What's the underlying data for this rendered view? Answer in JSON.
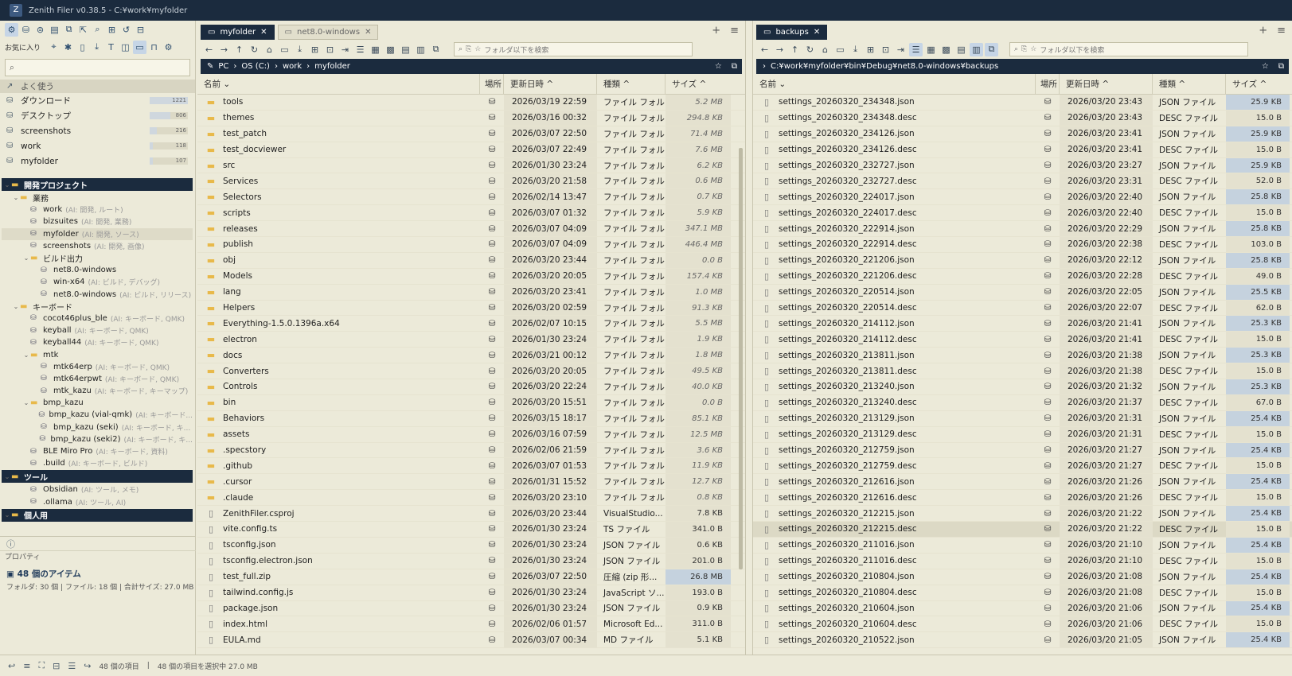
{
  "window_title": "Zenith Filer v0.38.5 - C:¥work¥myfolder",
  "left": {
    "fav_label": "お気に入り",
    "search_placeholder": "",
    "favorites_header": "よく使う",
    "favorites": [
      {
        "label": "ダウンロード",
        "count": "1221",
        "fill": 1.0
      },
      {
        "label": "デスクトップ",
        "count": "806",
        "fill": 0.55
      },
      {
        "label": "screenshots",
        "count": "216",
        "fill": 0.18
      },
      {
        "label": "work",
        "count": "118",
        "fill": 0.09
      },
      {
        "label": "myfolder",
        "count": "107",
        "fill": 0.08
      }
    ],
    "tree": [
      {
        "kind": "grp",
        "label": "開発プロジェクト",
        "indent": 0
      },
      {
        "kind": "fold",
        "label": "業務",
        "indent": 1
      },
      {
        "kind": "drv",
        "label": "work",
        "tag": "(AI: 開発, ルート)",
        "indent": 2
      },
      {
        "kind": "drv",
        "label": "bizsuites",
        "tag": "(AI: 開発, 業務)",
        "indent": 2
      },
      {
        "kind": "drv",
        "label": "myfolder",
        "tag": "(AI: 開発, ソース)",
        "indent": 2,
        "sel": true
      },
      {
        "kind": "drv",
        "label": "screenshots",
        "tag": "(AI: 開発, 画像)",
        "indent": 2
      },
      {
        "kind": "fold",
        "label": "ビルド出力",
        "indent": 2
      },
      {
        "kind": "drv",
        "label": "net8.0-windows",
        "tag": "",
        "indent": 3
      },
      {
        "kind": "drv",
        "label": "win-x64",
        "tag": "(AI: ビルド, デバッグ)",
        "indent": 3
      },
      {
        "kind": "drv",
        "label": "net8.0-windows",
        "tag": "(AI: ビルド, リリース)",
        "indent": 3
      },
      {
        "kind": "fold",
        "label": "キーボード",
        "indent": 1
      },
      {
        "kind": "drv",
        "label": "cocot46plus_ble",
        "tag": "(AI: キーボード, QMK)",
        "indent": 2
      },
      {
        "kind": "drv",
        "label": "keyball",
        "tag": "(AI: キーボード, QMK)",
        "indent": 2
      },
      {
        "kind": "drv",
        "label": "keyball44",
        "tag": "(AI: キーボード, QMK)",
        "indent": 2
      },
      {
        "kind": "fold",
        "label": "mtk",
        "indent": 2
      },
      {
        "kind": "drv",
        "label": "mtk64erp",
        "tag": "(AI: キーボード, QMK)",
        "indent": 3
      },
      {
        "kind": "drv",
        "label": "mtk64erpwt",
        "tag": "(AI: キーボード, QMK)",
        "indent": 3
      },
      {
        "kind": "drv",
        "label": "mtk_kazu",
        "tag": "(AI: キーボード, キーマップ)",
        "indent": 3
      },
      {
        "kind": "fold",
        "label": "bmp_kazu",
        "indent": 2
      },
      {
        "kind": "drv",
        "label": "bmp_kazu (vial-qmk)",
        "tag": "(AI: キーボード...",
        "indent": 3
      },
      {
        "kind": "drv",
        "label": "bmp_kazu (seki)",
        "tag": "(AI: キーボード, キ...",
        "indent": 3
      },
      {
        "kind": "drv",
        "label": "bmp_kazu (seki2)",
        "tag": "(AI: キーボード, キ...",
        "indent": 3
      },
      {
        "kind": "drv",
        "label": "BLE Miro Pro",
        "tag": "(AI: キーボード, 資料)",
        "indent": 2
      },
      {
        "kind": "drv",
        "label": ".build",
        "tag": "(AI: キーボード, ビルド)",
        "indent": 2
      },
      {
        "kind": "grp",
        "label": "ツール",
        "indent": 0
      },
      {
        "kind": "drv",
        "label": "Obsidian",
        "tag": "(AI: ツール, メモ)",
        "indent": 2
      },
      {
        "kind": "drv",
        "label": ".ollama",
        "tag": "(AI: ツール, AI)",
        "indent": 2
      },
      {
        "kind": "grp",
        "label": "個人用",
        "indent": 0
      }
    ],
    "props_label": "プロパティ",
    "props_title": "48 個のアイテム",
    "props_summary": "フォルダ: 30 個 | ファイル: 18 個 | 合計サイズ: 27.0 MB"
  },
  "pane1": {
    "tabs": [
      "myfolder",
      "net8.0-windows"
    ],
    "search_placeholder": "フォルダ以下を検索",
    "breadcrumb": [
      "PC",
      "OS (C:)",
      "work",
      "myfolder"
    ],
    "columns": [
      "名前",
      "場所",
      "更新日時",
      "種類",
      "サイズ"
    ],
    "rows": [
      {
        "n": "tools",
        "d": "2026/03/19 22:59",
        "t": "ファイル フォル...",
        "s": "5.2 MB",
        "f": 1
      },
      {
        "n": "themes",
        "d": "2026/03/16 00:32",
        "t": "ファイル フォル...",
        "s": "294.8 KB",
        "f": 1
      },
      {
        "n": "test_patch",
        "d": "2026/03/07 22:50",
        "t": "ファイル フォル...",
        "s": "71.4 MB",
        "f": 1
      },
      {
        "n": "test_docviewer",
        "d": "2026/03/07 22:49",
        "t": "ファイル フォル...",
        "s": "7.6 MB",
        "f": 1
      },
      {
        "n": "src",
        "d": "2026/01/30 23:24",
        "t": "ファイル フォル...",
        "s": "6.2 KB",
        "f": 1
      },
      {
        "n": "Services",
        "d": "2026/03/20 21:58",
        "t": "ファイル フォル...",
        "s": "0.6 MB",
        "f": 1
      },
      {
        "n": "Selectors",
        "d": "2026/02/14 13:47",
        "t": "ファイル フォル...",
        "s": "0.7 KB",
        "f": 1
      },
      {
        "n": "scripts",
        "d": "2026/03/07 01:32",
        "t": "ファイル フォル...",
        "s": "5.9 KB",
        "f": 1
      },
      {
        "n": "releases",
        "d": "2026/03/07 04:09",
        "t": "ファイル フォル...",
        "s": "347.1 MB",
        "f": 1
      },
      {
        "n": "publish",
        "d": "2026/03/07 04:09",
        "t": "ファイル フォル...",
        "s": "446.4 MB",
        "f": 1
      },
      {
        "n": "obj",
        "d": "2026/03/20 23:44",
        "t": "ファイル フォル...",
        "s": "0.0 B",
        "f": 1
      },
      {
        "n": "Models",
        "d": "2026/03/20 20:05",
        "t": "ファイル フォル...",
        "s": "157.4 KB",
        "f": 1
      },
      {
        "n": "lang",
        "d": "2026/03/20 23:41",
        "t": "ファイル フォル...",
        "s": "1.0 MB",
        "f": 1
      },
      {
        "n": "Helpers",
        "d": "2026/03/20 02:59",
        "t": "ファイル フォル...",
        "s": "91.3 KB",
        "f": 1
      },
      {
        "n": "Everything-1.5.0.1396a.x64",
        "d": "2026/02/07 10:15",
        "t": "ファイル フォル...",
        "s": "5.5 MB",
        "f": 1
      },
      {
        "n": "electron",
        "d": "2026/01/30 23:24",
        "t": "ファイル フォル...",
        "s": "1.9 KB",
        "f": 1
      },
      {
        "n": "docs",
        "d": "2026/03/21 00:12",
        "t": "ファイル フォル...",
        "s": "1.8 MB",
        "f": 1
      },
      {
        "n": "Converters",
        "d": "2026/03/20 20:05",
        "t": "ファイル フォル...",
        "s": "49.5 KB",
        "f": 1
      },
      {
        "n": "Controls",
        "d": "2026/03/20 22:24",
        "t": "ファイル フォル...",
        "s": "40.0 KB",
        "f": 1
      },
      {
        "n": "bin",
        "d": "2026/03/20 15:51",
        "t": "ファイル フォル...",
        "s": "0.0 B",
        "f": 1
      },
      {
        "n": "Behaviors",
        "d": "2026/03/15 18:17",
        "t": "ファイル フォル...",
        "s": "85.1 KB",
        "f": 1
      },
      {
        "n": "assets",
        "d": "2026/03/16 07:59",
        "t": "ファイル フォル...",
        "s": "12.5 MB",
        "f": 1
      },
      {
        "n": ".specstory",
        "d": "2026/02/06 21:59",
        "t": "ファイル フォル...",
        "s": "3.6 KB",
        "f": 1
      },
      {
        "n": ".github",
        "d": "2026/03/07 01:53",
        "t": "ファイル フォル...",
        "s": "11.9 KB",
        "f": 1
      },
      {
        "n": ".cursor",
        "d": "2026/01/31 15:52",
        "t": "ファイル フォル...",
        "s": "12.7 KB",
        "f": 1
      },
      {
        "n": ".claude",
        "d": "2026/03/20 23:10",
        "t": "ファイル フォル...",
        "s": "0.8 KB",
        "f": 1
      },
      {
        "n": "ZenithFiler.csproj",
        "d": "2026/03/20 23:44",
        "t": "VisualStudio...",
        "s": "7.8 KB",
        "f": 0
      },
      {
        "n": "vite.config.ts",
        "d": "2026/01/30 23:24",
        "t": "TS ファイル",
        "s": "341.0 B",
        "f": 0
      },
      {
        "n": "tsconfig.json",
        "d": "2026/01/30 23:24",
        "t": "JSON ファイル",
        "s": "0.6 KB",
        "f": 0
      },
      {
        "n": "tsconfig.electron.json",
        "d": "2026/01/30 23:24",
        "t": "JSON ファイル",
        "s": "201.0 B",
        "f": 0
      },
      {
        "n": "test_full.zip",
        "d": "2026/03/07 22:50",
        "t": "圧縮 (zip 形...",
        "s": "26.8 MB",
        "f": 0,
        "hl": 1
      },
      {
        "n": "tailwind.config.js",
        "d": "2026/01/30 23:24",
        "t": "JavaScript ソ...",
        "s": "193.0 B",
        "f": 0
      },
      {
        "n": "package.json",
        "d": "2026/01/30 23:24",
        "t": "JSON ファイル",
        "s": "0.9 KB",
        "f": 0
      },
      {
        "n": "index.html",
        "d": "2026/02/06 01:57",
        "t": "Microsoft Ed...",
        "s": "311.0 B",
        "f": 0
      },
      {
        "n": "EULA.md",
        "d": "2026/03/07 00:34",
        "t": "MD ファイル",
        "s": "5.1 KB",
        "f": 0
      }
    ]
  },
  "pane2": {
    "tabs": [
      "backups"
    ],
    "search_placeholder": "フォルダ以下を検索",
    "path": "C:¥work¥myfolder¥bin¥Debug¥net8.0-windows¥backups",
    "columns": [
      "名前",
      "場所",
      "更新日時",
      "種類",
      "サイズ"
    ],
    "rows": [
      {
        "n": "settings_20260320_234348.json",
        "d": "2026/03/20 23:43",
        "t": "JSON ファイル",
        "s": "25.9 KB",
        "hl": 1
      },
      {
        "n": "settings_20260320_234348.desc",
        "d": "2026/03/20 23:43",
        "t": "DESC ファイル",
        "s": "15.0 B"
      },
      {
        "n": "settings_20260320_234126.json",
        "d": "2026/03/20 23:41",
        "t": "JSON ファイル",
        "s": "25.9 KB",
        "hl": 1
      },
      {
        "n": "settings_20260320_234126.desc",
        "d": "2026/03/20 23:41",
        "t": "DESC ファイル",
        "s": "15.0 B"
      },
      {
        "n": "settings_20260320_232727.json",
        "d": "2026/03/20 23:27",
        "t": "JSON ファイル",
        "s": "25.9 KB",
        "hl": 1
      },
      {
        "n": "settings_20260320_232727.desc",
        "d": "2026/03/20 23:31",
        "t": "DESC ファイル",
        "s": "52.0 B"
      },
      {
        "n": "settings_20260320_224017.json",
        "d": "2026/03/20 22:40",
        "t": "JSON ファイル",
        "s": "25.8 KB",
        "hl": 1
      },
      {
        "n": "settings_20260320_224017.desc",
        "d": "2026/03/20 22:40",
        "t": "DESC ファイル",
        "s": "15.0 B"
      },
      {
        "n": "settings_20260320_222914.json",
        "d": "2026/03/20 22:29",
        "t": "JSON ファイル",
        "s": "25.8 KB",
        "hl": 1
      },
      {
        "n": "settings_20260320_222914.desc",
        "d": "2026/03/20 22:38",
        "t": "DESC ファイル",
        "s": "103.0 B"
      },
      {
        "n": "settings_20260320_221206.json",
        "d": "2026/03/20 22:12",
        "t": "JSON ファイル",
        "s": "25.8 KB",
        "hl": 1
      },
      {
        "n": "settings_20260320_221206.desc",
        "d": "2026/03/20 22:28",
        "t": "DESC ファイル",
        "s": "49.0 B"
      },
      {
        "n": "settings_20260320_220514.json",
        "d": "2026/03/20 22:05",
        "t": "JSON ファイル",
        "s": "25.5 KB",
        "hl": 1
      },
      {
        "n": "settings_20260320_220514.desc",
        "d": "2026/03/20 22:07",
        "t": "DESC ファイル",
        "s": "62.0 B"
      },
      {
        "n": "settings_20260320_214112.json",
        "d": "2026/03/20 21:41",
        "t": "JSON ファイル",
        "s": "25.3 KB",
        "hl": 1
      },
      {
        "n": "settings_20260320_214112.desc",
        "d": "2026/03/20 21:41",
        "t": "DESC ファイル",
        "s": "15.0 B"
      },
      {
        "n": "settings_20260320_213811.json",
        "d": "2026/03/20 21:38",
        "t": "JSON ファイル",
        "s": "25.3 KB",
        "hl": 1
      },
      {
        "n": "settings_20260320_213811.desc",
        "d": "2026/03/20 21:38",
        "t": "DESC ファイル",
        "s": "15.0 B"
      },
      {
        "n": "settings_20260320_213240.json",
        "d": "2026/03/20 21:32",
        "t": "JSON ファイル",
        "s": "25.3 KB",
        "hl": 1
      },
      {
        "n": "settings_20260320_213240.desc",
        "d": "2026/03/20 21:37",
        "t": "DESC ファイル",
        "s": "67.0 B"
      },
      {
        "n": "settings_20260320_213129.json",
        "d": "2026/03/20 21:31",
        "t": "JSON ファイル",
        "s": "25.4 KB",
        "hl": 1
      },
      {
        "n": "settings_20260320_213129.desc",
        "d": "2026/03/20 21:31",
        "t": "DESC ファイル",
        "s": "15.0 B"
      },
      {
        "n": "settings_20260320_212759.json",
        "d": "2026/03/20 21:27",
        "t": "JSON ファイル",
        "s": "25.4 KB",
        "hl": 1
      },
      {
        "n": "settings_20260320_212759.desc",
        "d": "2026/03/20 21:27",
        "t": "DESC ファイル",
        "s": "15.0 B"
      },
      {
        "n": "settings_20260320_212616.json",
        "d": "2026/03/20 21:26",
        "t": "JSON ファイル",
        "s": "25.4 KB",
        "hl": 1
      },
      {
        "n": "settings_20260320_212616.desc",
        "d": "2026/03/20 21:26",
        "t": "DESC ファイル",
        "s": "15.0 B"
      },
      {
        "n": "settings_20260320_212215.json",
        "d": "2026/03/20 21:22",
        "t": "JSON ファイル",
        "s": "25.4 KB",
        "hl": 1
      },
      {
        "n": "settings_20260320_212215.desc",
        "d": "2026/03/20 21:22",
        "t": "DESC ファイル",
        "s": "15.0 B",
        "sel": 1
      },
      {
        "n": "settings_20260320_211016.json",
        "d": "2026/03/20 21:10",
        "t": "JSON ファイル",
        "s": "25.4 KB",
        "hl": 1
      },
      {
        "n": "settings_20260320_211016.desc",
        "d": "2026/03/20 21:10",
        "t": "DESC ファイル",
        "s": "15.0 B"
      },
      {
        "n": "settings_20260320_210804.json",
        "d": "2026/03/20 21:08",
        "t": "JSON ファイル",
        "s": "25.4 KB",
        "hl": 1
      },
      {
        "n": "settings_20260320_210804.desc",
        "d": "2026/03/20 21:08",
        "t": "DESC ファイル",
        "s": "15.0 B"
      },
      {
        "n": "settings_20260320_210604.json",
        "d": "2026/03/20 21:06",
        "t": "JSON ファイル",
        "s": "25.4 KB",
        "hl": 1
      },
      {
        "n": "settings_20260320_210604.desc",
        "d": "2026/03/20 21:06",
        "t": "DESC ファイル",
        "s": "15.0 B"
      },
      {
        "n": "settings_20260320_210522.json",
        "d": "2026/03/20 21:05",
        "t": "JSON ファイル",
        "s": "25.4 KB",
        "hl": 1
      }
    ]
  },
  "status": {
    "items": "48 個の項目",
    "selection": "48 個の項目を選択中 27.0 MB"
  }
}
